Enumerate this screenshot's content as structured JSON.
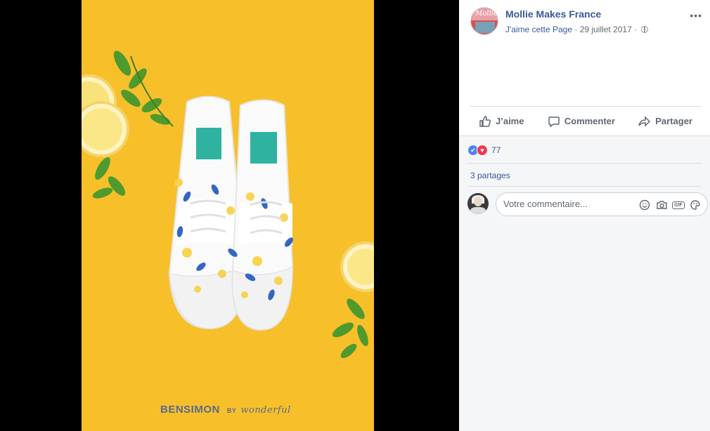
{
  "post": {
    "page_name": "Mollie Makes France",
    "like_page": "J'aime cette Page",
    "separator": " · ",
    "date": "29 juillet 2017",
    "date_separator": " · ",
    "more": "•••"
  },
  "avatar": {
    "text": "Mollie"
  },
  "photo": {
    "brand": "BENSIMON",
    "by": "BY",
    "partner": "wonderful"
  },
  "actions": {
    "like": "J’aime",
    "comment": "Commenter",
    "share": "Partager"
  },
  "feedback": {
    "reaction_count": "77",
    "shares": "3 partages",
    "comment_placeholder": "Votre commentaire...",
    "gif_label": "GIF"
  },
  "colors": {
    "link": "#385898",
    "photo_background": "#f7bf2a",
    "like_reaction": "#4e83f5",
    "love_reaction": "#f0384f"
  },
  "icons": [
    "globe-icon",
    "more-icon",
    "like-icon",
    "comment-icon",
    "share-icon",
    "emoji-icon",
    "camera-icon",
    "gif-icon",
    "sticker-icon"
  ]
}
